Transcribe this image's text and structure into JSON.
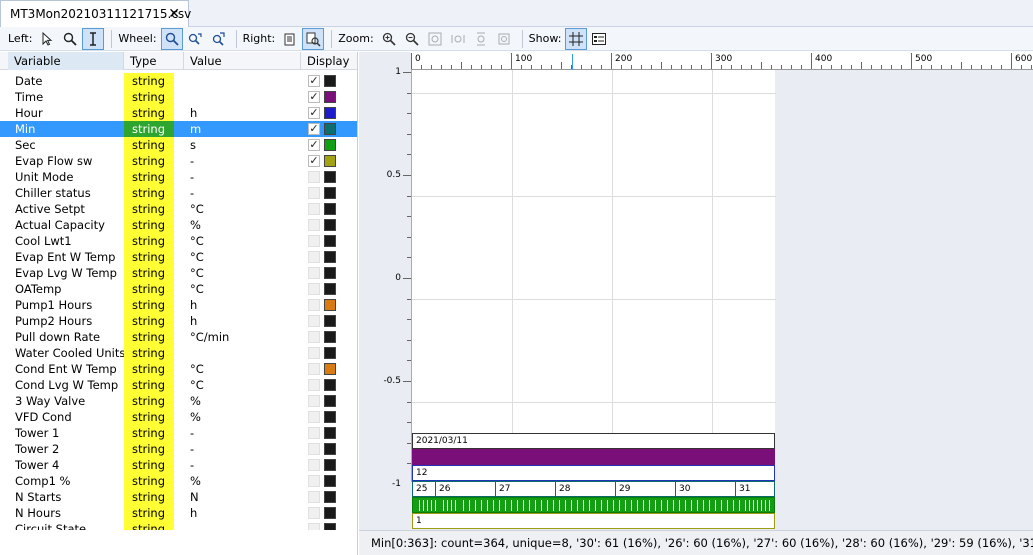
{
  "tab": {
    "title": "MT3Mon20210311121715.csv",
    "close": "✕"
  },
  "toolbar": {
    "left": "Left:",
    "wheel": "Wheel:",
    "right": "Right:",
    "zoom": "Zoom:",
    "show": "Show:"
  },
  "table": {
    "headers": {
      "variable": "Variable",
      "type": "Type",
      "value": "Value",
      "display": "Display"
    },
    "rows": [
      {
        "name": "Date",
        "type": "string",
        "value": "",
        "checked": true,
        "color": "#1a1a1a"
      },
      {
        "name": "Time",
        "type": "string",
        "value": "",
        "checked": true,
        "color": "#7a0f7a"
      },
      {
        "name": "Hour",
        "type": "string",
        "value": "h",
        "checked": true,
        "color": "#1c1ccc"
      },
      {
        "name": "Min",
        "type": "string",
        "value": "m",
        "checked": true,
        "color": "#0e6e6e",
        "selected": true
      },
      {
        "name": "Sec",
        "type": "string",
        "value": "s",
        "checked": true,
        "color": "#12a012"
      },
      {
        "name": "Evap Flow sw",
        "type": "string",
        "value": "-",
        "checked": true,
        "color": "#a3a312"
      },
      {
        "name": "Unit Mode",
        "type": "string",
        "value": "-",
        "checked": false,
        "color": "#1a1a1a"
      },
      {
        "name": "Chiller status",
        "type": "string",
        "value": "-",
        "checked": false,
        "color": "#1a1a1a"
      },
      {
        "name": "Active Setpt",
        "type": "string",
        "value": "°C",
        "checked": false,
        "color": "#1a1a1a"
      },
      {
        "name": "Actual Capacity",
        "type": "string",
        "value": "%",
        "checked": false,
        "color": "#1a1a1a"
      },
      {
        "name": "Cool Lwt1",
        "type": "string",
        "value": "°C",
        "checked": false,
        "color": "#1a1a1a"
      },
      {
        "name": "Evap Ent W Temp",
        "type": "string",
        "value": "°C",
        "checked": false,
        "color": "#1a1a1a"
      },
      {
        "name": "Evap Lvg W Temp",
        "type": "string",
        "value": "°C",
        "checked": false,
        "color": "#1a1a1a"
      },
      {
        "name": "OATemp",
        "type": "string",
        "value": "°C",
        "checked": false,
        "color": "#1a1a1a"
      },
      {
        "name": "Pump1 Hours",
        "type": "string",
        "value": "h",
        "checked": false,
        "color": "#d97a12"
      },
      {
        "name": "Pump2 Hours",
        "type": "string",
        "value": "h",
        "checked": false,
        "color": "#1a1a1a"
      },
      {
        "name": "Pull down Rate",
        "type": "string",
        "value": "°C/min",
        "checked": false,
        "color": "#1a1a1a"
      },
      {
        "name": "Water Cooled Units I",
        "type": "string",
        "value": "",
        "checked": false,
        "color": "#1a1a1a"
      },
      {
        "name": "Cond Ent W Temp",
        "type": "string",
        "value": "°C",
        "checked": false,
        "color": "#d97a12"
      },
      {
        "name": "Cond Lvg W Temp",
        "type": "string",
        "value": "°C",
        "checked": false,
        "color": "#1a1a1a"
      },
      {
        "name": "3 Way Valve",
        "type": "string",
        "value": "%",
        "checked": false,
        "color": "#1a1a1a"
      },
      {
        "name": "VFD Cond",
        "type": "string",
        "value": "%",
        "checked": false,
        "color": "#1a1a1a"
      },
      {
        "name": "Tower 1",
        "type": "string",
        "value": "-",
        "checked": false,
        "color": "#1a1a1a"
      },
      {
        "name": "Tower 2",
        "type": "string",
        "value": "-",
        "checked": false,
        "color": "#1a1a1a"
      },
      {
        "name": "Tower 4",
        "type": "string",
        "value": "-",
        "checked": false,
        "color": "#1a1a1a"
      },
      {
        "name": "Comp1 %",
        "type": "string",
        "value": "%",
        "checked": false,
        "color": "#1a1a1a"
      },
      {
        "name": "N Starts",
        "type": "string",
        "value": "N",
        "checked": false,
        "color": "#1a1a1a"
      },
      {
        "name": "N Hours",
        "type": "string",
        "value": "h",
        "checked": false,
        "color": "#1a1a1a"
      },
      {
        "name": "Circuit State",
        "type": "string",
        "value": "",
        "checked": false,
        "color": "#1a1a1a"
      }
    ]
  },
  "plot": {
    "x_ticks": [
      "0",
      "100",
      "200",
      "300",
      "400",
      "500",
      "600"
    ],
    "y_ticks": [
      "1",
      "0.5",
      "0",
      "-0.5",
      "-1"
    ],
    "lanes": {
      "date": "2021/03/11",
      "hour": "12",
      "min_segments": [
        "25",
        "26",
        "27",
        "28",
        "29",
        "30",
        "31"
      ],
      "flow": "1"
    }
  },
  "status": {
    "text": "Min[0:363]: count=364, unique=8, '30': 61 (16%), '26': 60 (16%), '27': 60 (16%), '28': 60 (16%), '29': 59 (16%), '31': 41 (11%), '25': 2"
  }
}
